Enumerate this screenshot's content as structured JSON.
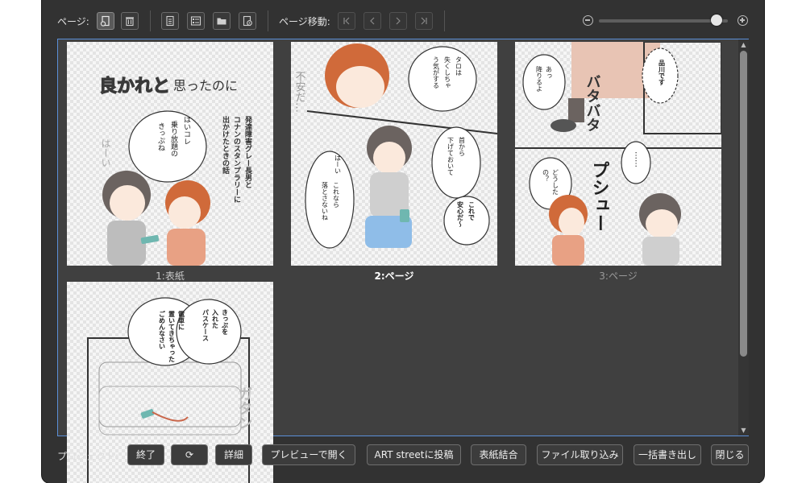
{
  "toolbar": {
    "page_label": "ページ:",
    "page_nav_label": "ページ移動:",
    "zoom_level": 0.95
  },
  "pages": [
    {
      "caption": "1:表紙",
      "cover_title_a": "良かれと",
      "cover_title_b": "思ったのに",
      "subtitle_lines": [
        "発達障害グレー長男と",
        "コナンのスタンプラリーに",
        "出かけたときの話"
      ],
      "bubble_lines": [
        "はいコレ",
        "乗り放題の",
        "きっぷね"
      ],
      "sfx": "はーい"
    },
    {
      "caption": "2:ページ",
      "bubble_a": [
        "タロは",
        "失くしちゃ",
        "う気がする"
      ],
      "bubble_b": [
        "首から",
        "下げておいて"
      ],
      "bubble_c": [
        "はーい"
      ],
      "bubble_d": [
        "これなら",
        "落とさないね"
      ],
      "bubble_e": [
        "これで",
        "安心だ〜"
      ],
      "sfx": "不安だ…"
    },
    {
      "caption": "3:ページ",
      "bubble_a": [
        "あっ",
        "降りるよ"
      ],
      "bubble_b": [
        "品川です"
      ],
      "bubble_c": [
        "どうした",
        "の？"
      ],
      "sfx_a": "バタバタ",
      "sfx_b": "プシュー",
      "dots": "……"
    },
    {
      "caption": "",
      "bubble_a": [
        "きっぷを",
        "入れた",
        "パスケース"
      ],
      "bubble_b": [
        "電車に",
        "置いてきちゃった",
        "ごめんなさい"
      ],
      "sfx": "ガタン"
    }
  ],
  "bottom": {
    "project_label": "プロジェクト:",
    "buttons": [
      "終了",
      "⟳",
      "詳細",
      "プレビューで開く",
      "ART streetに投稿",
      "表紙結合",
      "ファイル取り込み",
      "一括書き出し",
      "閉じる"
    ]
  },
  "colors": {
    "window_bg": "#323232",
    "panel_bg": "#404040",
    "selection_border": "#5b8fd8",
    "hair_boy": "#6b6360",
    "hair_mom": "#d06a3a",
    "shirt_mom": "#e8a184",
    "shorts_boy": "#8fbde8"
  }
}
